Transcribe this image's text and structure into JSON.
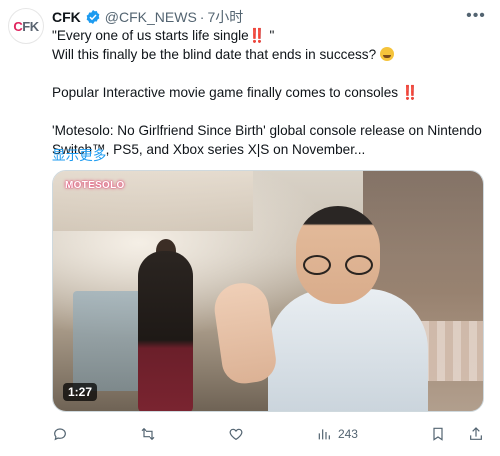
{
  "author": {
    "avatar_logo": {
      "part1": "C",
      "part2": "FK"
    },
    "name": "CFK",
    "handle": "@CFK_NEWS",
    "separator": "·",
    "time": "7小时"
  },
  "tweet": {
    "line1_text": "\"Every one of us starts life single",
    "line1_emoji": "‼️",
    "line1_end": " \"",
    "line2": "Will this finally be the blind date that ends in success?",
    "line3_text": "Popular Interactive movie game finally comes to consoles",
    "line3_emoji": "‼️",
    "line4": "'Motesolo: No Girlfriend Since Birth' global console release on Nintendo",
    "line5": "Switch™, PS5, and Xbox series X|S on November...",
    "show_more": "显示更多"
  },
  "media": {
    "overlay_title": "MOTESOLO",
    "duration": "1:27"
  },
  "actions": {
    "reply": {
      "icon": "reply-icon"
    },
    "retweet": {
      "icon": "retweet-icon"
    },
    "like": {
      "icon": "heart-icon"
    },
    "views": {
      "icon": "views-chart-icon",
      "count": "243"
    },
    "bookmark": {
      "icon": "bookmark-icon"
    },
    "share": {
      "icon": "share-icon"
    }
  },
  "colors": {
    "accent": "#1d9bf0",
    "secondary_text": "#536471",
    "alert_red": "#e0245e"
  }
}
